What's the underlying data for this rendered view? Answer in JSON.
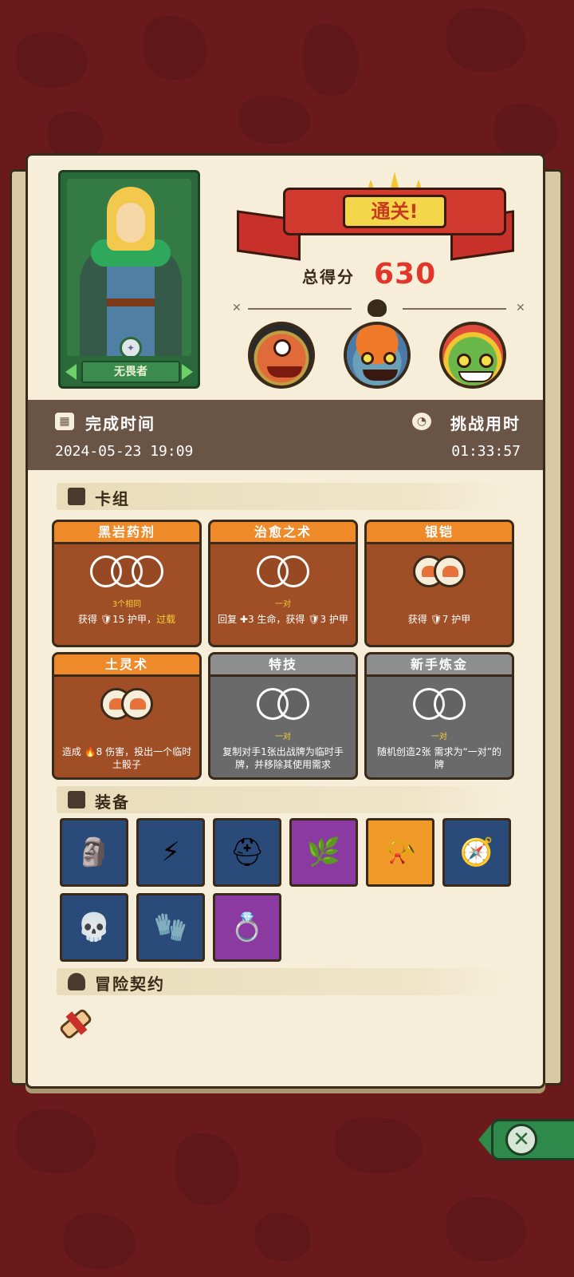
{
  "hero": {
    "name": "无畏者"
  },
  "result": {
    "title": "通关!",
    "score_label": "总得分",
    "score": "630"
  },
  "stats": {
    "completion_label": "完成时间",
    "completion_value": "2024-05-23 19:09",
    "duration_label": "挑战用时",
    "duration_value": "01:33:57"
  },
  "deck": {
    "header": "卡组",
    "cards": [
      {
        "title": "黑岩药剂",
        "slots": 3,
        "sub": "3个相同",
        "desc_a": "获得 ",
        "desc_icon": "🛡",
        "desc_b": "15 护甲，",
        "desc_hi": "过载",
        "style": "o"
      },
      {
        "title": "治愈之术",
        "slots": 2,
        "sub": "一对",
        "desc_a": "回复 ",
        "desc_icon": "✚",
        "desc_b": "3 生命，获得 🛡3 护甲",
        "desc_hi": "",
        "style": "o"
      },
      {
        "title": "银铠",
        "slots": 2,
        "filled": true,
        "sub": "",
        "desc_a": "获得 ",
        "desc_icon": "🛡",
        "desc_b": "7 护甲",
        "desc_hi": "",
        "style": "o"
      },
      {
        "title": "土灵术",
        "slots": 2,
        "filled": true,
        "sub": "",
        "desc_a": "造成 ",
        "desc_icon": "🔥",
        "desc_b": "8 伤害，投出一个临时土骰子",
        "desc_hi": "",
        "style": "o"
      },
      {
        "title": "特技",
        "slots": 2,
        "sub": "一对",
        "desc_a": "复制对手1张出战牌为临时手牌，并移除其使用需求",
        "desc_icon": "",
        "desc_b": "",
        "desc_hi": "",
        "style": "g"
      },
      {
        "title": "新手炼金",
        "slots": 2,
        "sub": "一对",
        "desc_a": "随机创造2张 需求为“一对”的牌",
        "desc_icon": "",
        "desc_b": "",
        "desc_hi": "",
        "style": "g"
      }
    ]
  },
  "equipment": {
    "header": "装备",
    "items": [
      {
        "name": "totem-icon",
        "glyph": "🗿",
        "color": "b"
      },
      {
        "name": "lightning-orb-icon",
        "glyph": "⚡",
        "color": "b"
      },
      {
        "name": "helmet-icon",
        "glyph": "⛑",
        "color": "b"
      },
      {
        "name": "herb-icon",
        "glyph": "🌿",
        "color": "p"
      },
      {
        "name": "horn-icon",
        "glyph": "📯",
        "color": "y"
      },
      {
        "name": "armor-compass-icon",
        "glyph": "🧭",
        "color": "b"
      },
      {
        "name": "skull-icon",
        "glyph": "💀",
        "color": "b"
      },
      {
        "name": "gauntlet-icon",
        "glyph": "🧤",
        "color": "b"
      },
      {
        "name": "ring-icon",
        "glyph": "💍",
        "color": "p"
      }
    ]
  },
  "contract": {
    "header": "冒险契约"
  },
  "colors": {
    "accent": "#e2362a",
    "banner": "#d03a2e",
    "panel": "#f6eed8",
    "card_orange": "#ee8a2a",
    "card_gray": "#8e8e8e"
  }
}
